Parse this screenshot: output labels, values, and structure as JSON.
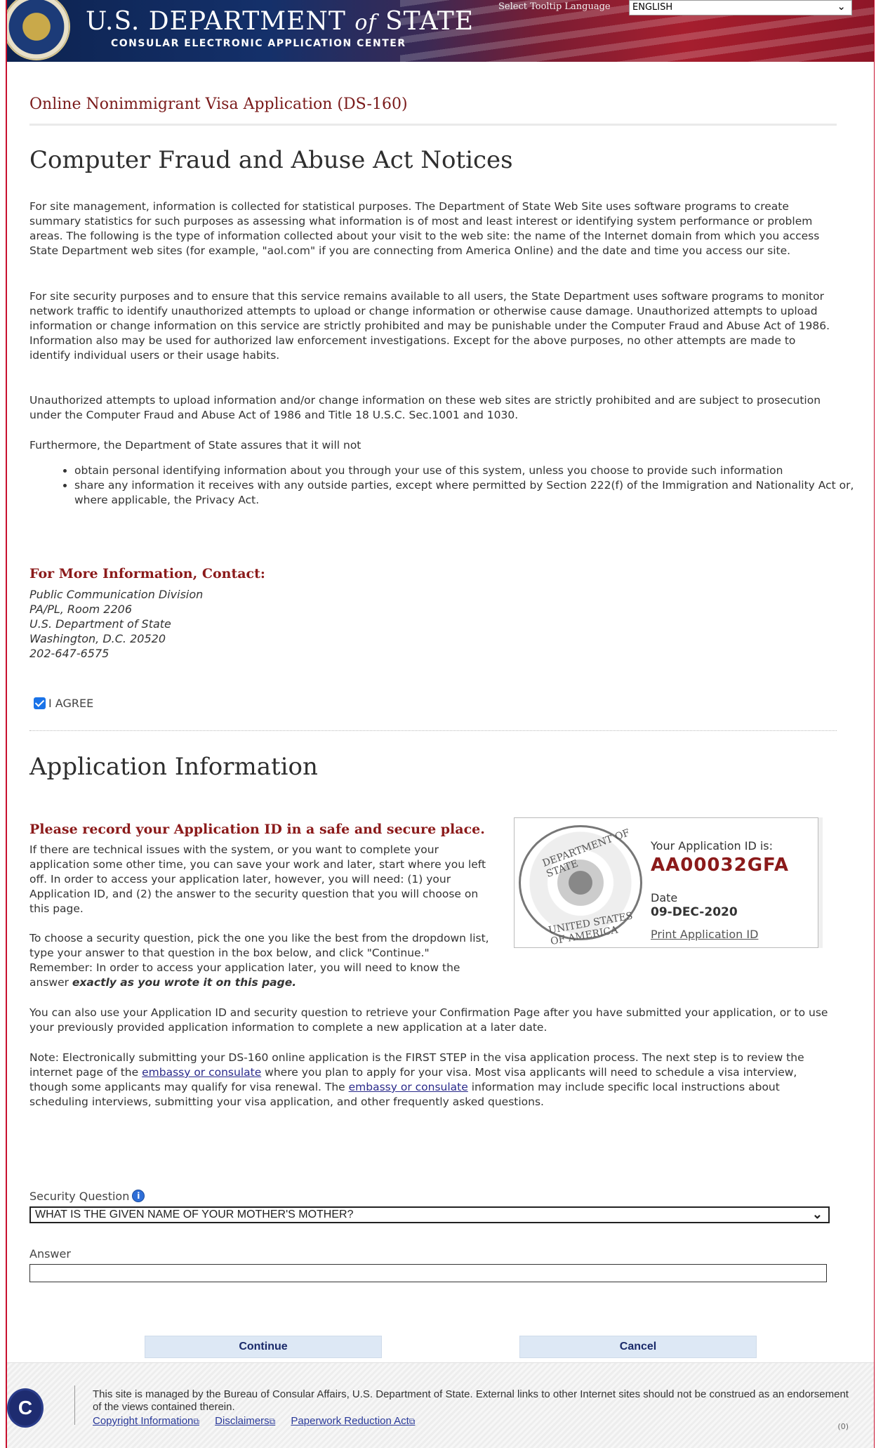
{
  "header": {
    "dept_title_a": "U.S. DEPARTMENT ",
    "dept_title_of": "of",
    "dept_title_b": " STATE",
    "subtitle": "CONSULAR ELECTRONIC APPLICATION CENTER",
    "tooltip_language_label": "Select Tooltip Language",
    "tooltip_language_value": "ENGLISH"
  },
  "breadcrumb": "Online Nonimmigrant Visa Application (DS-160)",
  "notice": {
    "heading": "Computer Fraud and Abuse Act Notices",
    "p1": "For site management, information is collected for statistical purposes. The Department of State Web Site uses software programs to create summary statistics for such purposes as assessing what information is of most and least interest or identifying system performance or problem areas. The following is the type of information collected about your visit to the web site: the name of the Internet domain from which you access State Department web sites (for example, \"aol.com\" if you are connecting from America Online) and the date and time you access our site.",
    "p2": "For site security purposes and to ensure that this service remains available to all users, the State Department uses software programs to monitor network traffic to identify unauthorized attempts to upload or change information or otherwise cause damage. Unauthorized attempts to upload information or change information on this service are strictly prohibited and may be punishable under the Computer Fraud and Abuse Act of 1986. Information also may be used for authorized law enforcement investigations. Except for the above purposes, no other attempts are made to identify individual users or their usage habits.",
    "p3": "Unauthorized attempts to upload information and/or change information on these web sites are strictly prohibited and are subject to prosecution under the Computer Fraud and Abuse Act of 1986 and Title 18 U.S.C. Sec.1001 and 1030.",
    "p4": "Furthermore, the Department of State assures that it will not",
    "bullets": [
      "obtain personal identifying information about you through your use of this system, unless you choose to provide such information",
      "share any information it receives with any outside parties, except where permitted by Section 222(f) of the Immigration and Nationality Act or, where applicable, the Privacy Act."
    ]
  },
  "contact": {
    "heading": "For More Information, Contact:",
    "lines": [
      "Public Communication Division",
      "PA/PL, Room 2206",
      "U.S. Department of State",
      "Washington, D.C. 20520",
      "202-647-6575"
    ]
  },
  "agree": {
    "label": "I AGREE",
    "checked": true
  },
  "application": {
    "heading": "Application Information",
    "record_heading": "Please record your Application ID in a safe and secure place.",
    "p1": "If there are technical issues with the system, or you want to complete your application some other time, you can save your work and later, start where you left off. In order to access your application later, however, you will need: (1) your Application ID, and (2) the answer to the security question that you will choose on this page.",
    "p2_start": "To choose a security question, pick the one you like the best from the dropdown list, type your answer to that question in the box below, and click \"Continue.\" Remember: In order to access your application later, you will need to know the answer ",
    "p2_emph": "exactly as you wrote it on this page.",
    "p3": "You can also use your Application ID and security question to retrieve your Confirmation Page after you have submitted your application, or to use your previously provided application information to complete a new application at a later date.",
    "p4_a": "Note: Electronically submitting your DS-160 online application is the FIRST STEP in the visa application process. The next step is to review the internet page of the ",
    "p4_link1": "embassy or consulate",
    "p4_b": " where you plan to apply for your visa. Most visa applicants will need to schedule a visa interview, though some applicants may qualify for visa renewal. The ",
    "p4_link2": "embassy or consulate",
    "p4_c": " information may include specific local instructions about scheduling interviews, submitting your visa application, and other frequently asked questions.",
    "id_box": {
      "seal_top": "DEPARTMENT OF STATE",
      "seal_bottom": "UNITED STATES OF AMERICA",
      "id_label": "Your Application ID is:",
      "id_value": "AA00032GFA",
      "date_label": "Date",
      "date_value": "09-DEC-2020",
      "print_link": "Print Application ID"
    }
  },
  "form": {
    "security_label": "Security Question",
    "security_value": "WHAT IS THE GIVEN NAME OF YOUR MOTHER'S MOTHER?",
    "answer_label": "Answer",
    "answer_value": "",
    "continue_label": "Continue",
    "cancel_label": "Cancel"
  },
  "footer": {
    "text": "This site is managed by the Bureau of Consular Affairs, U.S. Department of State. External links to other Internet sites should not be construed as an endorsement of the views contained therein.",
    "links": [
      "Copyright Information",
      "Disclaimers",
      "Paperwork Reduction Act"
    ],
    "version": "(0)"
  }
}
